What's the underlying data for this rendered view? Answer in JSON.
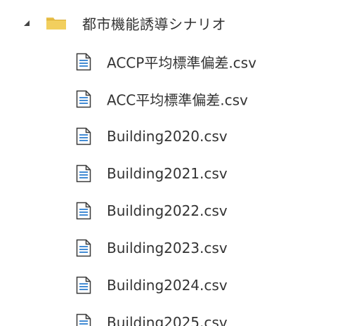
{
  "tree": {
    "folder": {
      "label": "都市機能誘導シナリオ",
      "expanded": true,
      "icon": "folder-icon",
      "color": "#e8bf4a"
    },
    "files": [
      {
        "label": "ACCP平均標準偏差.csv",
        "icon": "csv-file-icon"
      },
      {
        "label": "ACC平均標準偏差.csv",
        "icon": "csv-file-icon"
      },
      {
        "label": "Building2020.csv",
        "icon": "csv-file-icon"
      },
      {
        "label": "Building2021.csv",
        "icon": "csv-file-icon"
      },
      {
        "label": "Building2022.csv",
        "icon": "csv-file-icon"
      },
      {
        "label": "Building2023.csv",
        "icon": "csv-file-icon"
      },
      {
        "label": "Building2024.csv",
        "icon": "csv-file-icon"
      },
      {
        "label": "Building2025.csv",
        "icon": "csv-file-icon"
      }
    ]
  }
}
